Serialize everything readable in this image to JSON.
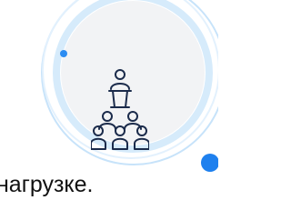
{
  "caption": {
    "text": "нагрузке."
  },
  "icon": {
    "name": "audience-speaker-icon",
    "stroke_color": "#1b2b4b"
  },
  "colors": {
    "ring": "#c7e3fa",
    "ring_soft": "#d6ebfb",
    "disc": "#f2f3f5",
    "accent_dot": "#1e80ee"
  }
}
